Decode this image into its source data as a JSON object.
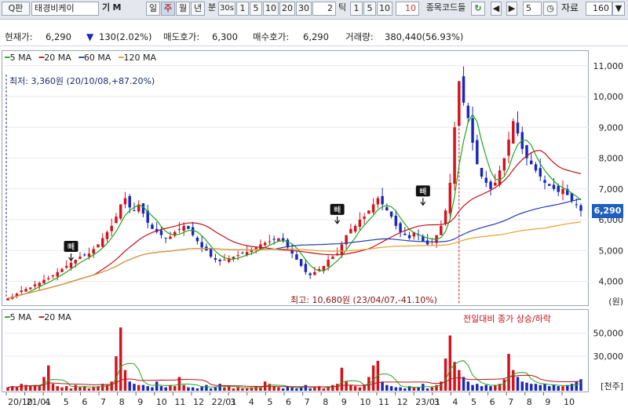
{
  "toolbar": {
    "search_icon_label": "Q판",
    "stock_name": "태경비케이",
    "buttons_left": [
      "기",
      "M"
    ],
    "periods": [
      "일",
      "주",
      "월",
      "년"
    ],
    "min_label": "분",
    "sec_label": "30s",
    "intervals": [
      "1",
      "5",
      "10",
      "20",
      "30"
    ],
    "tick_input": "2",
    "tick_label": "틱",
    "tick_intervals": [
      "1",
      "5",
      "10"
    ],
    "tick_input2": "10",
    "code_label": "종목코드들",
    "count_input": "5",
    "data_label": "자료",
    "data_count": "160"
  },
  "info": {
    "price_label": "현재가:",
    "price_value": "6,290",
    "change_value": "130(2.02%)",
    "ask_label": "매도호가:",
    "ask_value": "6,300",
    "bid_label": "매수호가:",
    "bid_value": "6,290",
    "volume_label": "거래량:",
    "volume_value": "380,440(56.93%)"
  },
  "legend": {
    "ma5": "5 MA",
    "ma20": "20 MA",
    "ma60": "60 MA",
    "ma120": "120 MA",
    "vol_ma5": "5 MA",
    "vol_ma20": "20 MA",
    "vol_note": "전일대비 종가 상승/하락"
  },
  "annotations": {
    "low": "최저: 3,360원 (20/10/08,+87.20%)",
    "high": "최고: 10,680원 (23/04/07,-41.10%)",
    "current_price": "6,290",
    "marker": "빼"
  },
  "colors": {
    "up": "#d4121b",
    "down": "#1a28b8",
    "ma5": "#1fa81f",
    "ma20": "#c0121b",
    "ma60": "#1f3fb0",
    "ma120": "#e8a02a"
  },
  "chart_data": {
    "type": "candlestick",
    "price_axis": {
      "ticks": [
        "4,000",
        "5,000",
        "6,000",
        "7,000",
        "8,000",
        "9,000",
        "10,000",
        "11,000"
      ],
      "unit": "(원)",
      "ylim": [
        3300,
        11300
      ]
    },
    "volume_axis": {
      "ticks": [
        "30,000",
        "50,000"
      ],
      "unit": "[천주]"
    },
    "x_labels": [
      "20/10",
      "21/01",
      "4",
      "5",
      "6",
      "7",
      "8",
      "9",
      "10",
      "11",
      "12",
      "22/01",
      "3",
      "4",
      "5",
      "6",
      "7",
      "8",
      "9",
      "10",
      "11",
      "12",
      "23/01",
      "3",
      "4",
      "5",
      "6",
      "7",
      "8",
      "9",
      "10"
    ],
    "close": [
      3450,
      3500,
      3600,
      3700,
      3750,
      3800,
      3900,
      3950,
      4050,
      4100,
      4200,
      4300,
      4400,
      4500,
      4600,
      4700,
      4800,
      4850,
      4900,
      5050,
      5200,
      5400,
      5600,
      5800,
      6100,
      6500,
      6700,
      6400,
      6300,
      6500,
      6200,
      5900,
      5700,
      5600,
      5500,
      5400,
      5450,
      5600,
      5700,
      5800,
      5700,
      5500,
      5300,
      5100,
      5000,
      4800,
      4700,
      4650,
      4700,
      4750,
      4800,
      4850,
      4900,
      4950,
      5000,
      5100,
      5200,
      5250,
      5300,
      5350,
      5400,
      5300,
      5100,
      4900,
      4700,
      4500,
      4300,
      4200,
      4300,
      4400,
      4500,
      4700,
      4800,
      4900,
      5200,
      5500,
      5700,
      5800,
      6000,
      6100,
      6300,
      6500,
      6700,
      6500,
      6300,
      6100,
      5800,
      5600,
      5500,
      5400,
      5600,
      5500,
      5300,
      5200,
      5300,
      5500,
      5800,
      6300,
      7200,
      9000,
      10500,
      9800,
      9300,
      8500,
      7800,
      7400,
      7200,
      7000,
      7200,
      7600,
      8000,
      8600,
      9200,
      8800,
      8300,
      8000,
      7800,
      7600,
      7400,
      7200,
      7100,
      7000,
      6900,
      7000,
      6800,
      6600,
      6500,
      6290
    ],
    "volume": [
      3,
      4,
      3,
      6,
      5,
      4,
      5,
      4,
      12,
      22,
      6,
      4,
      3,
      4,
      2,
      5,
      3,
      4,
      2,
      3,
      4,
      6,
      5,
      8,
      30,
      55,
      18,
      8,
      6,
      5,
      5,
      4,
      3,
      8,
      4,
      3,
      5,
      4,
      12,
      5,
      3,
      3,
      2,
      4,
      5,
      2,
      3,
      6,
      3,
      4,
      2,
      3,
      2,
      2,
      3,
      4,
      3,
      8,
      6,
      4,
      3,
      2,
      4,
      3,
      2,
      3,
      5,
      2,
      3,
      4,
      2,
      3,
      5,
      6,
      20,
      8,
      5,
      4,
      3,
      5,
      12,
      22,
      26,
      8,
      5,
      4,
      3,
      3,
      2,
      4,
      3,
      3,
      6,
      2,
      3,
      5,
      8,
      28,
      48,
      25,
      18,
      12,
      8,
      5,
      6,
      4,
      5,
      4,
      5,
      6,
      10,
      32,
      18,
      12,
      8,
      7,
      6,
      6,
      5,
      6,
      4,
      5,
      4,
      4,
      5,
      6,
      8,
      10
    ]
  }
}
